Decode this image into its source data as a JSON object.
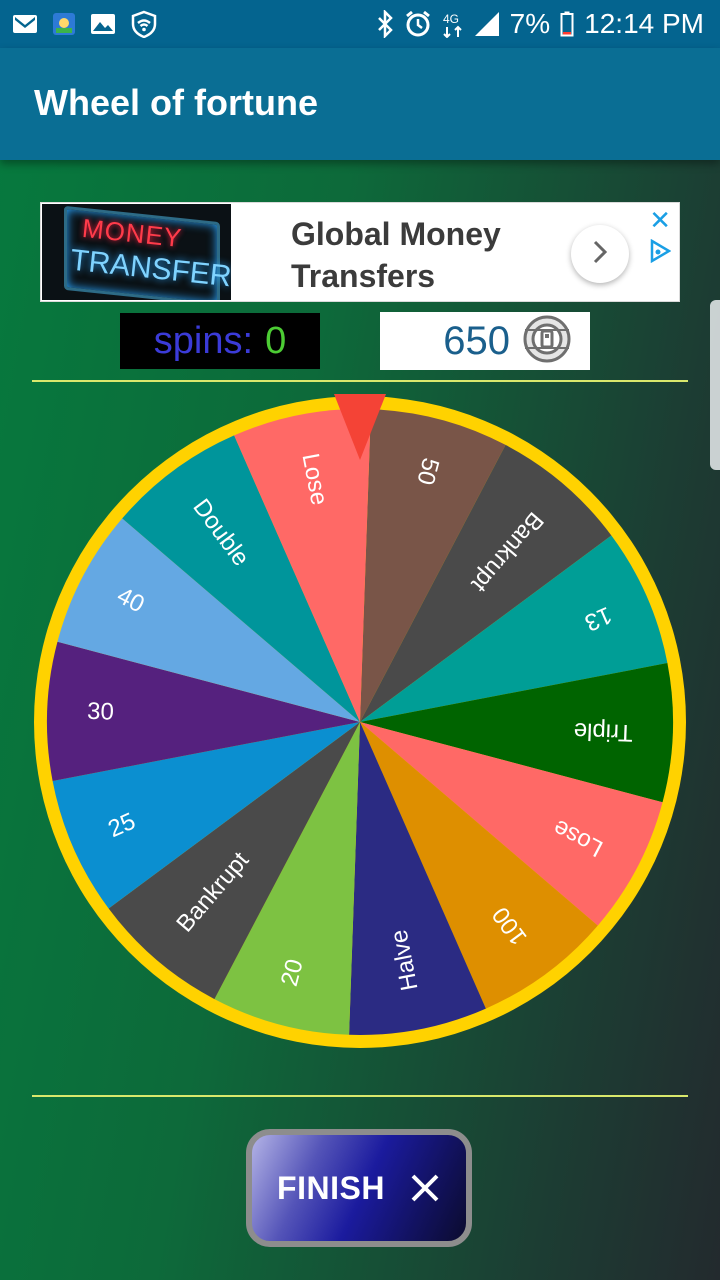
{
  "status_bar": {
    "battery_percent": "7%",
    "time": "12:14 PM",
    "network_label": "4G",
    "icons_left": [
      "gmail-icon",
      "game-notification-icon",
      "gallery-icon",
      "wifi-shield-icon"
    ],
    "icons_right": [
      "bluetooth-icon",
      "alarm-icon",
      "network-icon",
      "signal-icon",
      "battery-icon"
    ]
  },
  "app_bar": {
    "title": "Wheel of fortune"
  },
  "ad": {
    "image_line1": "MONEY",
    "image_line2": "TRANSFER",
    "title": "Global Money Transfers",
    "open_icon": "chevron-right-icon",
    "close_label": "✕"
  },
  "stats": {
    "spins_label": "spins:",
    "spins_value": "0",
    "coins_value": "650",
    "coin_icon": "coin-icon"
  },
  "wheel": {
    "segments": [
      {
        "label": "50",
        "color": "#795548"
      },
      {
        "label": "Bankrupt",
        "color": "#4a4a4a"
      },
      {
        "label": "13",
        "color": "#009e96"
      },
      {
        "label": "Triple",
        "color": "#006400"
      },
      {
        "label": "Lose",
        "color": "#ff6966"
      },
      {
        "label": "100",
        "color": "#de8f00"
      },
      {
        "label": "Halve",
        "color": "#2b2b83"
      },
      {
        "label": "20",
        "color": "#7dc242"
      },
      {
        "label": "Bankrupt",
        "color": "#4a4a4a"
      },
      {
        "label": "25",
        "color": "#0b8fd0"
      },
      {
        "label": "30",
        "color": "#55217e"
      },
      {
        "label": "40",
        "color": "#64a8e3"
      },
      {
        "label": "Double",
        "color": "#00959b"
      },
      {
        "label": "Lose",
        "color": "#ff6966"
      }
    ],
    "rim_color": "#ffd200",
    "pointer_color": "#f44336"
  },
  "finish_button": {
    "label": "FINISH",
    "icon": "close-icon"
  }
}
